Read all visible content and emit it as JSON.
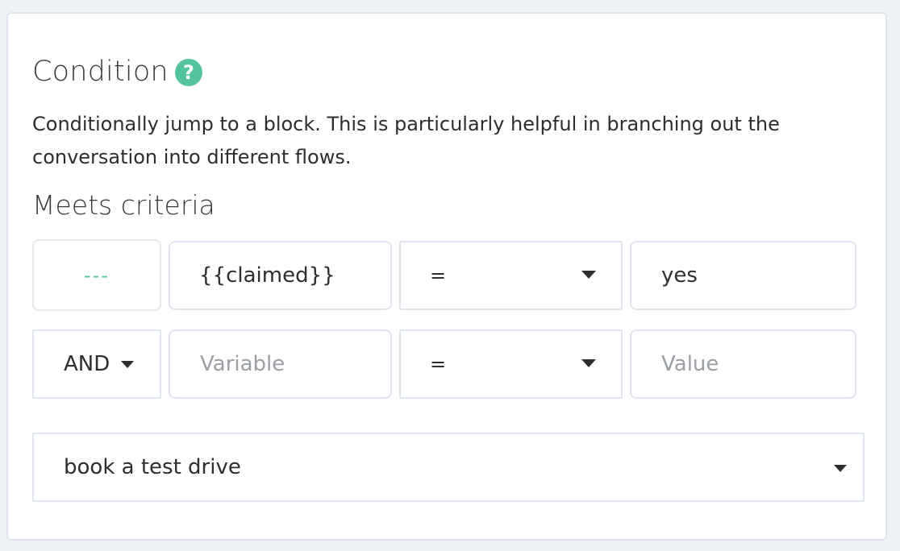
{
  "header": {
    "title": "Condition",
    "help_icon": "question-circle-icon",
    "description": "Conditionally jump to a block. This is particularly helpful in branching out the conversation into different flows."
  },
  "criteria": {
    "label": "Meets criteria",
    "rows": [
      {
        "connector": "---",
        "variable_value": "{{claimed}}",
        "variable_placeholder": "Variable",
        "operator": "=",
        "value_value": "yes",
        "value_placeholder": "Value"
      },
      {
        "connector": "AND",
        "variable_value": "",
        "variable_placeholder": "Variable",
        "operator": "=",
        "value_value": "",
        "value_placeholder": "Value"
      }
    ]
  },
  "target_block": {
    "selected": "book a test drive"
  },
  "colors": {
    "accent": "#54c49f",
    "border": "#dfe5ee",
    "background": "#eef1f6"
  }
}
